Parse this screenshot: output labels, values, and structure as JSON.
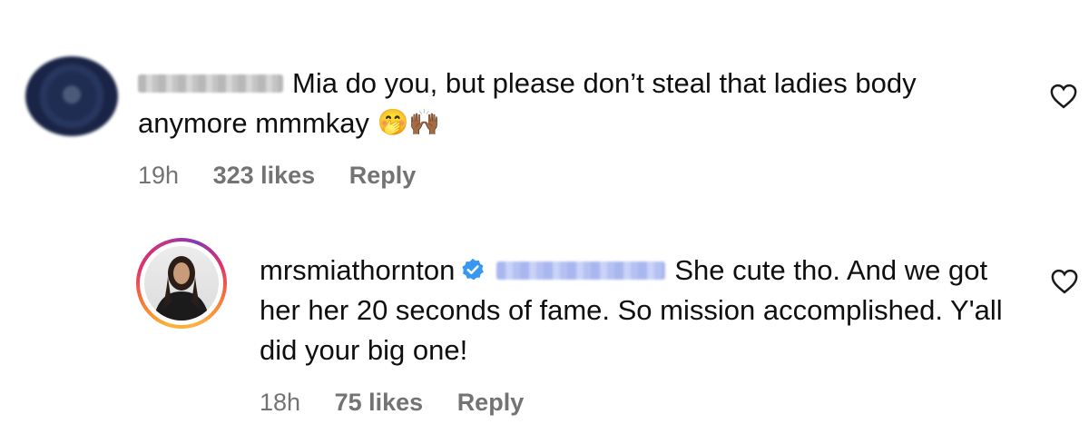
{
  "comments": [
    {
      "redacted_username": true,
      "text": "Mia do you, but please don’t steal that ladies body anymore mmmkay",
      "emojis": "🤭🙌🏾",
      "time": "19h",
      "likes": "323 likes",
      "reply_label": "Reply",
      "like_icon": "heart-outline-icon"
    },
    {
      "username": "mrsmiathornton",
      "verified": true,
      "mention_redacted": true,
      "text": "She cute tho. And we got her her 20 seconds of fame. So mission accomplished. Y'all did your big one!",
      "time": "18h",
      "likes": "75 likes",
      "reply_label": "Reply",
      "like_icon": "heart-outline-icon"
    }
  ],
  "colors": {
    "meta_text": "#737373",
    "verified_blue": "#3897f0",
    "mention_blur": "#a9b7ef"
  }
}
